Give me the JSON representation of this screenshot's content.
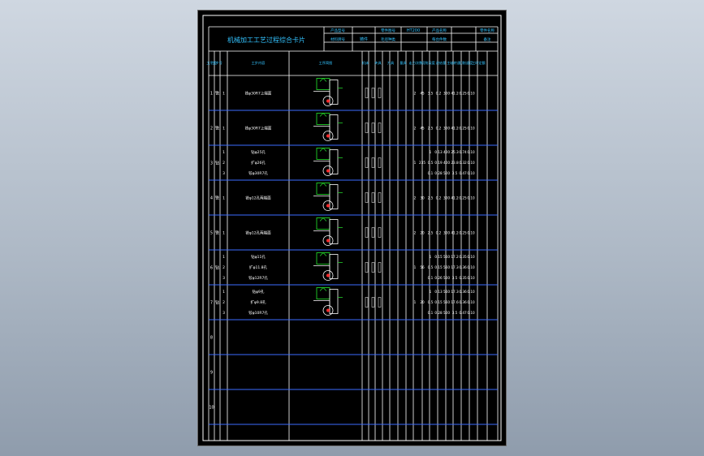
{
  "card": {
    "title": "机械加工工艺过程综合卡片",
    "header_labels": [
      "产品型号",
      "零件图号",
      "产品名称",
      "零件名称",
      "材料牌号",
      "毛坯种类",
      "每台件数",
      "备注"
    ],
    "header_values": [
      "HT200",
      "铸件"
    ],
    "column_headers": [
      "工序号",
      "工步号",
      "工步内容",
      "工序简图",
      "机床",
      "夹具",
      "刀具",
      "量具",
      "走刀次数",
      "切削深度",
      "进给量",
      "主轴转速",
      "切削速度",
      "工时定额"
    ]
  },
  "rows": [
    {
      "no": "1",
      "op": "铣",
      "steps": [
        {
          "n": "1",
          "text": "铣φ30R7上端面",
          "params": [
            "2",
            "45",
            "3.5",
            "0.2",
            "300",
            "41.2",
            "0.25",
            "0.10"
          ]
        }
      ]
    },
    {
      "no": "2",
      "op": "铣",
      "steps": [
        {
          "n": "1",
          "text": "铣φ30R7上端面",
          "params": [
            "2",
            "45",
            "2.5",
            "0.2",
            "300",
            "41.2",
            "0.25",
            "0.10"
          ]
        }
      ]
    },
    {
      "no": "3",
      "op": "钻",
      "steps": [
        {
          "n": "1",
          "text": "钻φ25孔",
          "params": [
            "1",
            "0.13",
            "400",
            "25.3",
            "0.74",
            "0.10"
          ]
        },
        {
          "n": "2",
          "text": "扩φ26孔",
          "params": [
            "1",
            "235",
            "0.5",
            "0.19",
            "400",
            "23.8",
            "0.32",
            "0.10"
          ]
        },
        {
          "n": "3",
          "text": "铰φ30R7孔",
          "params": [
            "0.1",
            "0.28",
            "500",
            "3.5",
            "0.47",
            "0.10"
          ]
        }
      ]
    },
    {
      "no": "4",
      "op": "铣",
      "steps": [
        {
          "n": "1",
          "text": "铣φ12孔两端面",
          "params": [
            "2",
            "30",
            "2.5",
            "0.2",
            "300",
            "41.2",
            "0.25",
            "0.10"
          ]
        }
      ]
    },
    {
      "no": "5",
      "op": "铣",
      "steps": [
        {
          "n": "1",
          "text": "铣φ12孔两端面",
          "params": [
            "2",
            "20",
            "2.5",
            "0.2",
            "300",
            "41.2",
            "0.25",
            "0.10"
          ]
        }
      ]
    },
    {
      "no": "6",
      "op": "钻",
      "steps": [
        {
          "n": "1",
          "text": "钻φ11孔",
          "params": [
            "1",
            "0.15",
            "560",
            "17.2",
            "0.35",
            "0.10"
          ]
        },
        {
          "n": "2",
          "text": "扩φ11.8孔",
          "params": [
            "1",
            "56",
            "0.5",
            "0.15",
            "560",
            "17.3",
            "0.36",
            "0.10"
          ]
        },
        {
          "n": "3",
          "text": "铰φ12R7孔",
          "params": [
            "0.1",
            "0.26",
            "500",
            "3.5",
            "0.35",
            "0.10"
          ]
        }
      ]
    },
    {
      "no": "7",
      "op": "钻",
      "steps": [
        {
          "n": "1",
          "text": "钻φ9孔",
          "params": [
            "1",
            "0.13",
            "560",
            "17.3",
            "0.36",
            "0.10"
          ]
        },
        {
          "n": "2",
          "text": "扩φ9.8孔",
          "params": [
            "1",
            "20",
            "0.5",
            "0.15",
            "560",
            "17.6",
            "0.36",
            "0.10"
          ]
        },
        {
          "n": "3",
          "text": "铰φ10R7孔",
          "params": [
            "0.1",
            "0.28",
            "500",
            "3.5",
            "0.47",
            "0.10"
          ]
        }
      ]
    },
    {
      "no": "8",
      "op": "",
      "steps": []
    },
    {
      "no": "9",
      "op": "",
      "steps": []
    },
    {
      "no": "10",
      "op": "",
      "steps": []
    }
  ],
  "colors": {
    "background": "#b6c0cc",
    "sheet": "#000000",
    "line_white": "#ffffff",
    "line_blue": "#3d6cff",
    "text_cyan": "#33c3ff",
    "geom_green": "#22d02a",
    "geom_red": "#ff2a2a"
  }
}
